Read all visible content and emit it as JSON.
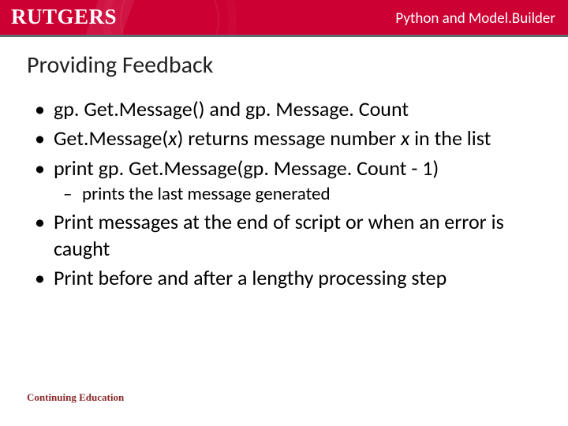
{
  "brand": {
    "logo_text": "RUTGERS"
  },
  "header": {
    "course_title": "Python and Model.Builder"
  },
  "title": "Providing Feedback",
  "bullets": [
    {
      "text": "gp. Get.Message() and gp. Message. Count"
    },
    {
      "pre": "Get.Message(",
      "italic1": "x",
      "mid": ") returns message number ",
      "italic2": "x",
      "post": " in the list"
    },
    {
      "text": "print gp. Get.Message(gp. Message. Count - 1)",
      "sub": [
        {
          "text": "prints the last message generated"
        }
      ]
    },
    {
      "text": "Print messages at the end of script or when an error is caught"
    },
    {
      "text": "Print before and after a lengthy processing step"
    }
  ],
  "footer": {
    "text": "Continuing Education"
  }
}
